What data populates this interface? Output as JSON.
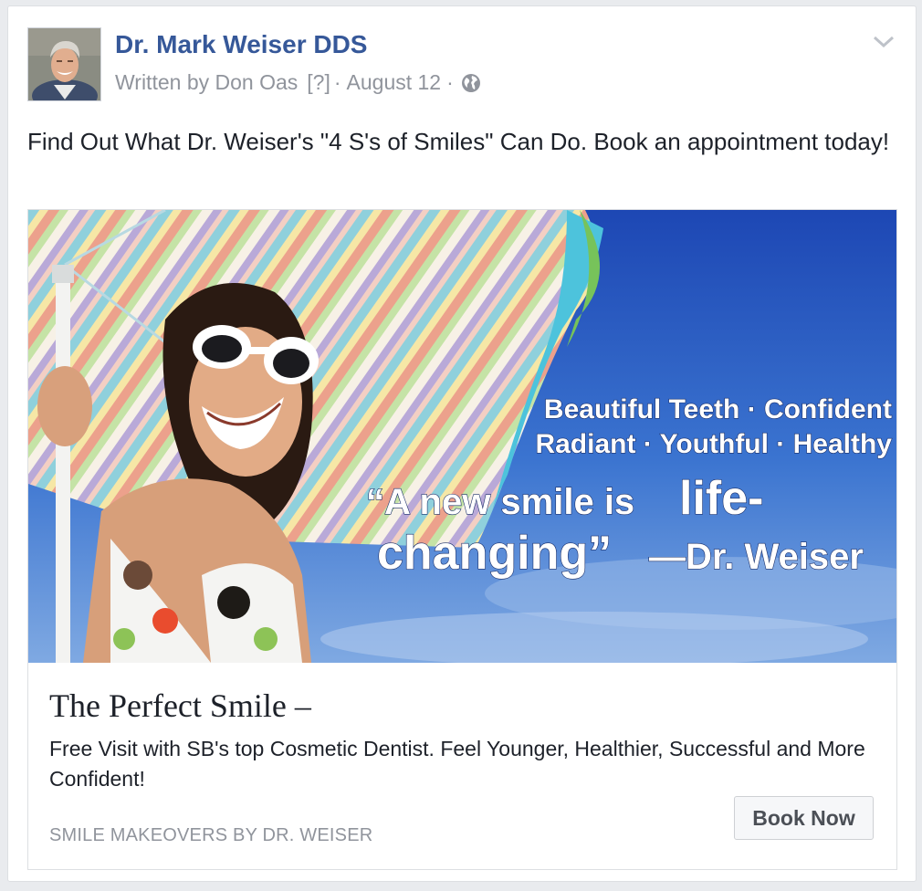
{
  "post": {
    "page_name": "Dr. Mark Weiser DDS",
    "written_by": "Written by Don Oas",
    "help_marker": "[?]",
    "separator": "·",
    "date": "August 12",
    "privacy_icon": "globe-icon",
    "menu_icon": "chevron-down-icon",
    "avatar_icon": "profile-photo",
    "body_text": "Find Out What Dr. Weiser's \"4 S's of Smiles\" Can Do. Book an appointment today!"
  },
  "ad": {
    "image": {
      "line1": "Beautiful Teeth · Confident",
      "line2": "Radiant · Youthful · Healthy",
      "quote_a": "“A new smile is",
      "quote_b": "life-",
      "quote_c": "changing”",
      "quote_d": "—Dr. Weiser"
    },
    "title": "The Perfect Smile –",
    "description": "Free Visit with SB's top Cosmetic Dentist. Feel Younger, Healthier, Successful and More Confident!",
    "domain": "SMILE MAKEOVERS BY DR. WEISER",
    "cta_label": "Book Now"
  },
  "colors": {
    "link": "#365899",
    "meta": "#90949c",
    "text": "#1d2129",
    "sky": "#2f63c5"
  }
}
